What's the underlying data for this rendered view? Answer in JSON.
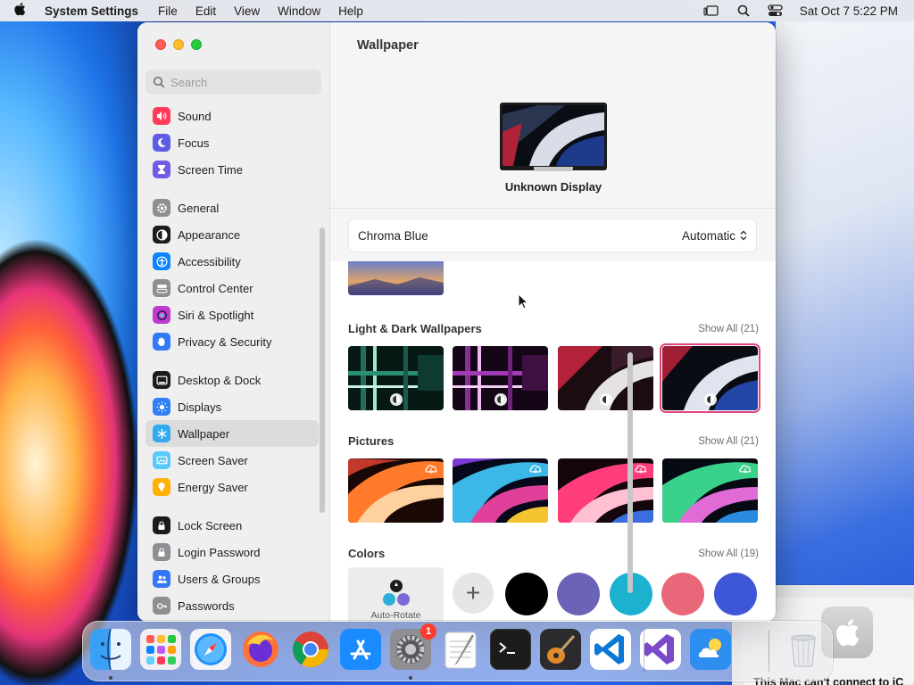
{
  "menubar": {
    "app_name": "System Settings",
    "menus": [
      "File",
      "Edit",
      "View",
      "Window",
      "Help"
    ],
    "clock": "Sat Oct 7  5:22 PM"
  },
  "sidebar": {
    "search_placeholder": "Search",
    "groups": [
      [
        {
          "label": "Sound",
          "icon": "speaker-icon",
          "color": "#ff3b5c"
        },
        {
          "label": "Focus",
          "icon": "moon-icon",
          "color": "#5e5ce6"
        },
        {
          "label": "Screen Time",
          "icon": "hourglass-icon",
          "color": "#6e5ce6"
        }
      ],
      [
        {
          "label": "General",
          "icon": "gear-icon",
          "color": "#8e8e93"
        },
        {
          "label": "Appearance",
          "icon": "appearance-icon",
          "color": "#1c1c1e"
        },
        {
          "label": "Accessibility",
          "icon": "accessibility-icon",
          "color": "#0a84ff"
        },
        {
          "label": "Control Center",
          "icon": "control-center-icon",
          "color": "#8e8e93"
        },
        {
          "label": "Siri & Spotlight",
          "icon": "siri-icon",
          "color": "#bf3ad1"
        },
        {
          "label": "Privacy & Security",
          "icon": "hand-icon",
          "color": "#3478f6"
        }
      ],
      [
        {
          "label": "Desktop & Dock",
          "icon": "dock-icon",
          "color": "#1c1c1e"
        },
        {
          "label": "Displays",
          "icon": "sun-icon",
          "color": "#2f7ff6"
        },
        {
          "label": "Wallpaper",
          "icon": "snowflake-icon",
          "color": "#33aaf0",
          "selected": true
        },
        {
          "label": "Screen Saver",
          "icon": "screen-saver-icon",
          "color": "#5ac8fa"
        },
        {
          "label": "Energy Saver",
          "icon": "bulb-icon",
          "color": "#ffb000"
        }
      ],
      [
        {
          "label": "Lock Screen",
          "icon": "lock-icon",
          "color": "#1c1c1e"
        },
        {
          "label": "Login Password",
          "icon": "lock-icon",
          "color": "#8e8e93"
        },
        {
          "label": "Users & Groups",
          "icon": "users-icon",
          "color": "#3478f6"
        },
        {
          "label": "Passwords",
          "icon": "key-icon",
          "color": "#8e8e93"
        }
      ]
    ]
  },
  "main": {
    "title": "Wallpaper",
    "display_name": "Unknown Display",
    "picker": {
      "name": "Chroma Blue",
      "mode": "Automatic"
    },
    "sections": {
      "light_dark": {
        "title": "Light & Dark Wallpapers",
        "show_all": "Show All (21)"
      },
      "pictures": {
        "title": "Pictures",
        "show_all": "Show All (21)"
      },
      "colors": {
        "title": "Colors",
        "show_all": "Show All (19)"
      }
    },
    "auto_rotate_label": "Auto-Rotate",
    "color_swatches": [
      "#000000",
      "#6a63b8",
      "#1bb1cf",
      "#e8687a",
      "#3e56d8"
    ],
    "accent": "#e0457b"
  },
  "notification": {
    "text": "This Mac can't connect to iC"
  },
  "dock": {
    "apps": [
      {
        "name": "Finder",
        "icon": "finder-icon",
        "running": true
      },
      {
        "name": "Launchpad",
        "icon": "launchpad-icon"
      },
      {
        "name": "Safari",
        "icon": "safari-icon"
      },
      {
        "name": "Firefox",
        "icon": "firefox-icon"
      },
      {
        "name": "Chrome",
        "icon": "chrome-icon"
      },
      {
        "name": "App Store",
        "icon": "app-store-icon"
      },
      {
        "name": "System Settings",
        "icon": "settings-icon",
        "running": true,
        "badge": "1"
      },
      {
        "name": "TextEdit",
        "icon": "textedit-icon"
      },
      {
        "name": "Terminal",
        "icon": "terminal-icon"
      },
      {
        "name": "Instruments",
        "icon": "guitar-icon"
      },
      {
        "name": "Visual Studio Code",
        "icon": "vscode-icon"
      },
      {
        "name": "Visual Studio",
        "icon": "visual-studio-icon"
      },
      {
        "name": "Weather",
        "icon": "weather-icon"
      },
      {
        "name": "Trash",
        "icon": "trash-icon"
      }
    ]
  }
}
